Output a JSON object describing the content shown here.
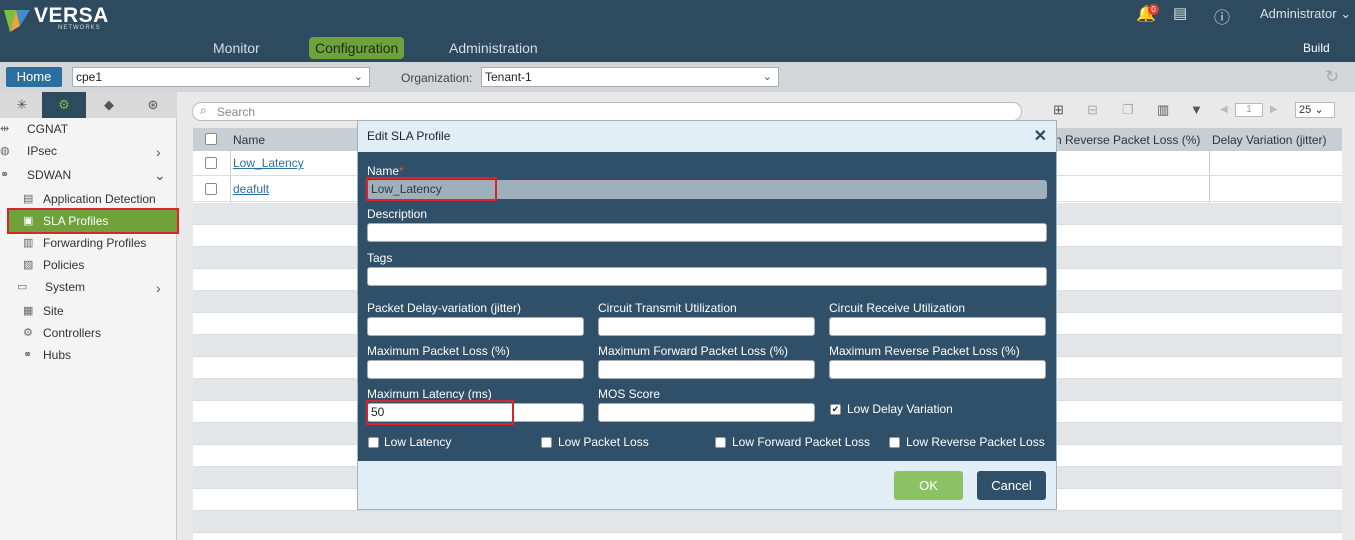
{
  "header": {
    "brand": "VERSA",
    "brand_sub": "NETWORKS",
    "nav": [
      "Monitor",
      "Configuration",
      "Administration"
    ],
    "notification_count": "0",
    "user": "Administrator",
    "build": "Build"
  },
  "toolbar2": {
    "home": "Home",
    "appliance": "cpe1",
    "org_label": "Organization:",
    "org": "Tenant-1"
  },
  "sidebar": {
    "items": [
      {
        "label": "CGNAT"
      },
      {
        "label": "IPsec"
      },
      {
        "label": "SDWAN"
      },
      {
        "label": "Application Detection"
      },
      {
        "label": "SLA Profiles"
      },
      {
        "label": "Forwarding Profiles"
      },
      {
        "label": "Policies"
      },
      {
        "label": "System"
      },
      {
        "label": "Site"
      },
      {
        "label": "Controllers"
      },
      {
        "label": "Hubs"
      }
    ]
  },
  "main": {
    "search_placeholder": "Search",
    "page_number": "1",
    "page_size": "25",
    "columns": {
      "name": "Name",
      "reverse_loss": "n Reverse Packet Loss (%)",
      "delay_variation": "Delay Variation (jitter)"
    },
    "rows": [
      {
        "name": "Low_Latency"
      },
      {
        "name": "deafult"
      }
    ]
  },
  "modal": {
    "title": "Edit SLA Profile",
    "fields": {
      "name_label": "Name",
      "name_required": "*",
      "name_value": "Low_Latency",
      "description_label": "Description",
      "tags_label": "Tags",
      "jitter_label": "Packet Delay-variation (jitter)",
      "circuit_tx_label": "Circuit Transmit Utilization",
      "circuit_rx_label": "Circuit Receive Utilization",
      "max_loss_label": "Maximum Packet Loss (%)",
      "max_fwd_loss_label": "Maximum Forward Packet Loss (%)",
      "max_rev_loss_label": "Maximum Reverse Packet Loss (%)",
      "max_latency_label": "Maximum Latency (ms)",
      "max_latency_value": "50",
      "mos_label": "MOS Score",
      "low_delay_variation": "Low Delay Variation",
      "low_latency": "Low Latency",
      "low_packet_loss": "Low Packet Loss",
      "low_fwd_loss": "Low Forward Packet Loss",
      "low_rev_loss": "Low Reverse Packet Loss"
    },
    "checkbox_mark": "✔",
    "ok": "OK",
    "cancel": "Cancel"
  }
}
